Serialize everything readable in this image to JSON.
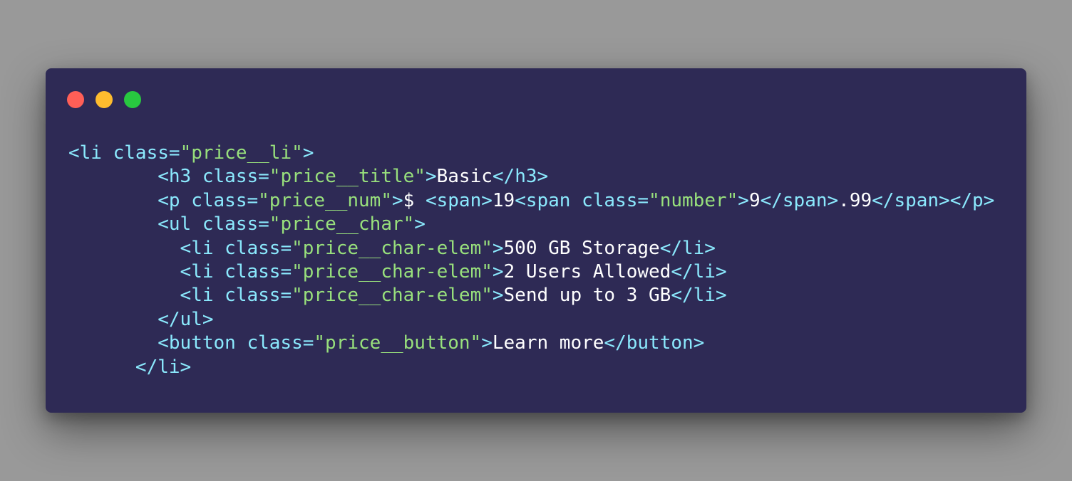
{
  "colors": {
    "background": "#999999",
    "window": "#2e2a55",
    "dot_close": "#ff5f57",
    "dot_minimize": "#febc2e",
    "dot_maximize": "#28c840",
    "tag": "#8be9fd",
    "string": "#98e07c",
    "text": "#ffffff"
  },
  "window_controls": [
    "close",
    "minimize",
    "maximize"
  ],
  "code_lines": [
    [
      {
        "t": "tag",
        "v": "<li "
      },
      {
        "t": "attr",
        "v": "class"
      },
      {
        "t": "eq",
        "v": "="
      },
      {
        "t": "str",
        "v": "\"price__li\""
      },
      {
        "t": "tag",
        "v": ">"
      }
    ],
    [
      {
        "t": "txt",
        "v": "        "
      },
      {
        "t": "tag",
        "v": "<h3 "
      },
      {
        "t": "attr",
        "v": "class"
      },
      {
        "t": "eq",
        "v": "="
      },
      {
        "t": "str",
        "v": "\"price__title\""
      },
      {
        "t": "tag",
        "v": ">"
      },
      {
        "t": "txt",
        "v": "Basic"
      },
      {
        "t": "tag",
        "v": "</h3>"
      }
    ],
    [
      {
        "t": "txt",
        "v": "        "
      },
      {
        "t": "tag",
        "v": "<p "
      },
      {
        "t": "attr",
        "v": "class"
      },
      {
        "t": "eq",
        "v": "="
      },
      {
        "t": "str",
        "v": "\"price__num\""
      },
      {
        "t": "tag",
        "v": ">"
      },
      {
        "t": "txt",
        "v": "$ "
      },
      {
        "t": "tag",
        "v": "<span>"
      },
      {
        "t": "txt",
        "v": "19"
      },
      {
        "t": "tag",
        "v": "<span "
      },
      {
        "t": "attr",
        "v": "class"
      },
      {
        "t": "eq",
        "v": "="
      },
      {
        "t": "str",
        "v": "\"number\""
      },
      {
        "t": "tag",
        "v": ">"
      },
      {
        "t": "txt",
        "v": "9"
      },
      {
        "t": "tag",
        "v": "</span>"
      },
      {
        "t": "txt",
        "v": ".99"
      },
      {
        "t": "tag",
        "v": "</span></p>"
      }
    ],
    [
      {
        "t": "txt",
        "v": "        "
      },
      {
        "t": "tag",
        "v": "<ul "
      },
      {
        "t": "attr",
        "v": "class"
      },
      {
        "t": "eq",
        "v": "="
      },
      {
        "t": "str",
        "v": "\"price__char\""
      },
      {
        "t": "tag",
        "v": ">"
      }
    ],
    [
      {
        "t": "txt",
        "v": "          "
      },
      {
        "t": "tag",
        "v": "<li "
      },
      {
        "t": "attr",
        "v": "class"
      },
      {
        "t": "eq",
        "v": "="
      },
      {
        "t": "str",
        "v": "\"price__char-elem\""
      },
      {
        "t": "tag",
        "v": ">"
      },
      {
        "t": "txt",
        "v": "500 GB Storage"
      },
      {
        "t": "tag",
        "v": "</li>"
      }
    ],
    [
      {
        "t": "txt",
        "v": "          "
      },
      {
        "t": "tag",
        "v": "<li "
      },
      {
        "t": "attr",
        "v": "class"
      },
      {
        "t": "eq",
        "v": "="
      },
      {
        "t": "str",
        "v": "\"price__char-elem\""
      },
      {
        "t": "tag",
        "v": ">"
      },
      {
        "t": "txt",
        "v": "2 Users Allowed"
      },
      {
        "t": "tag",
        "v": "</li>"
      }
    ],
    [
      {
        "t": "txt",
        "v": "          "
      },
      {
        "t": "tag",
        "v": "<li "
      },
      {
        "t": "attr",
        "v": "class"
      },
      {
        "t": "eq",
        "v": "="
      },
      {
        "t": "str",
        "v": "\"price__char-elem\""
      },
      {
        "t": "tag",
        "v": ">"
      },
      {
        "t": "txt",
        "v": "Send up to 3 GB"
      },
      {
        "t": "tag",
        "v": "</li>"
      }
    ],
    [
      {
        "t": "txt",
        "v": "        "
      },
      {
        "t": "tag",
        "v": "</ul>"
      }
    ],
    [
      {
        "t": "txt",
        "v": "        "
      },
      {
        "t": "tag",
        "v": "<button "
      },
      {
        "t": "attr",
        "v": "class"
      },
      {
        "t": "eq",
        "v": "="
      },
      {
        "t": "str",
        "v": "\"price__button\""
      },
      {
        "t": "tag",
        "v": ">"
      },
      {
        "t": "txt",
        "v": "Learn more"
      },
      {
        "t": "tag",
        "v": "</button>"
      }
    ],
    [
      {
        "t": "txt",
        "v": "      "
      },
      {
        "t": "tag",
        "v": "</li>"
      }
    ]
  ]
}
